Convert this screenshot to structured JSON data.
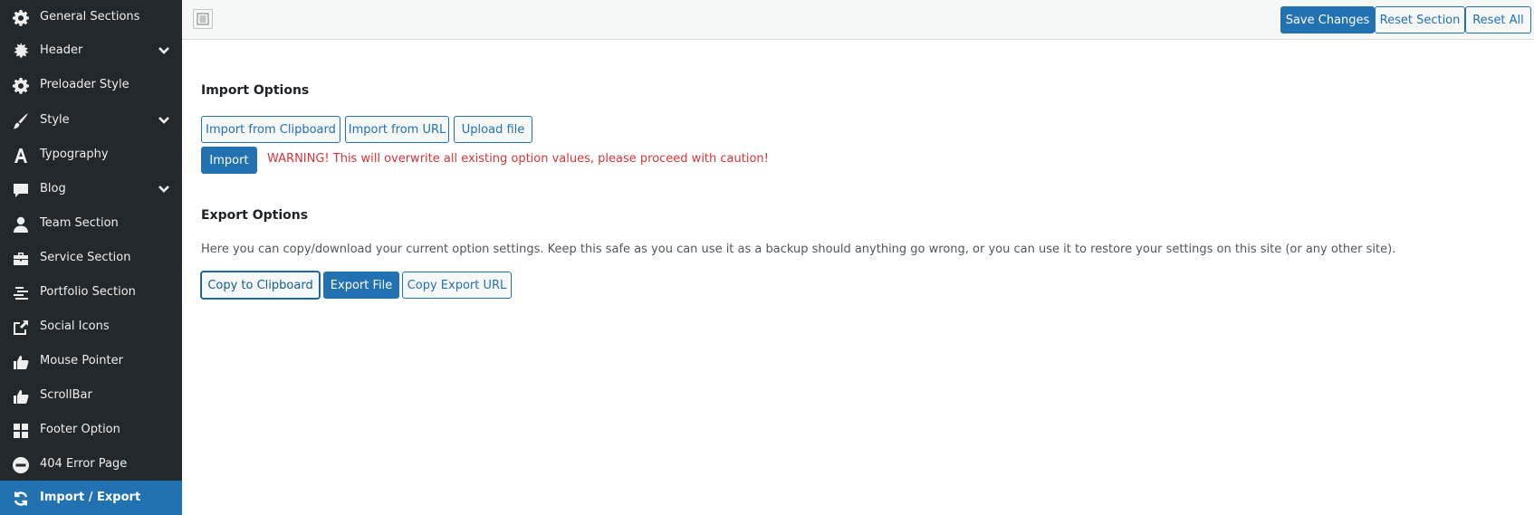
{
  "sidebar": {
    "items": [
      {
        "label": "General Sections",
        "icon": "gear-icon",
        "expandable": false,
        "active": false
      },
      {
        "label": "Header",
        "icon": "gear-burst-icon",
        "expandable": true,
        "active": false
      },
      {
        "label": "Preloader Style",
        "icon": "gear-icon",
        "expandable": false,
        "active": false
      },
      {
        "label": "Style",
        "icon": "brush-icon",
        "expandable": true,
        "active": false
      },
      {
        "label": "Typography",
        "icon": "typography-icon",
        "expandable": false,
        "active": false
      },
      {
        "label": "Blog",
        "icon": "comment-icon",
        "expandable": true,
        "active": false
      },
      {
        "label": "Team Section",
        "icon": "user-icon",
        "expandable": false,
        "active": false
      },
      {
        "label": "Service Section",
        "icon": "briefcase-icon",
        "expandable": false,
        "active": false
      },
      {
        "label": "Portfolio Section",
        "icon": "align-list-icon",
        "expandable": false,
        "active": false
      },
      {
        "label": "Social Icons",
        "icon": "share-icon",
        "expandable": false,
        "active": false
      },
      {
        "label": "Mouse Pointer",
        "icon": "thumbs-up-icon",
        "expandable": false,
        "active": false
      },
      {
        "label": "ScrollBar",
        "icon": "thumbs-up-icon",
        "expandable": false,
        "active": false
      },
      {
        "label": "Footer Option",
        "icon": "grid-icon",
        "expandable": false,
        "active": false
      },
      {
        "label": "404 Error Page",
        "icon": "minus-circle-icon",
        "expandable": false,
        "active": false
      },
      {
        "label": "Import / Export",
        "icon": "refresh-icon",
        "expandable": false,
        "active": true
      }
    ]
  },
  "toolbar": {
    "toggle_icon": "expand-sidebar-icon",
    "save_label": "Save Changes",
    "reset_section_label": "Reset Section",
    "reset_all_label": "Reset All"
  },
  "import": {
    "title": "Import Options",
    "clipboard_label": "Import from Clipboard",
    "url_label": "Import from URL",
    "upload_label": "Upload file",
    "import_label": "Import",
    "warning": "WARNING! This will overwrite all existing option values, please proceed with caution!"
  },
  "export": {
    "title": "Export Options",
    "description": "Here you can copy/download your current option settings. Keep this safe as you can use it as a backup should anything go wrong, or you can use it to restore your settings on this site (or any other site).",
    "copy_label": "Copy to Clipboard",
    "file_label": "Export File",
    "url_label": "Copy Export URL"
  },
  "colors": {
    "sidebar_bg": "#23282d",
    "accent": "#2271b1",
    "warning": "#d63638"
  }
}
